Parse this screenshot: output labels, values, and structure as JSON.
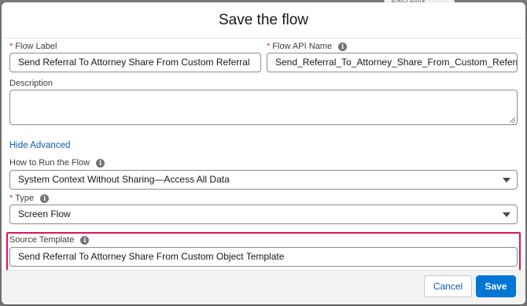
{
  "background": {
    "tab_label": "Auto-Layout"
  },
  "modal": {
    "title": "Save the flow",
    "flow_label": {
      "label": "Flow Label",
      "required": "*",
      "value": "Send Referral To Attorney Share From Custom Referral"
    },
    "flow_api_name": {
      "label": "Flow API Name",
      "required": "*",
      "value": "Send_Referral_To_Attorney_Share_From_Custom_Referral",
      "info_icon": "info-icon"
    },
    "description": {
      "label": "Description",
      "value": ""
    },
    "hide_advanced_link": "Hide Advanced",
    "run_mode": {
      "label": "How to Run the Flow",
      "value": "System Context Without Sharing—Access All Data",
      "info_icon": "info-icon"
    },
    "type": {
      "label": "Type",
      "required": "*",
      "value": "Screen Flow",
      "info_icon": "info-icon"
    },
    "source_template": {
      "label": "Source Template",
      "value": "Send Referral To Attorney Share From Custom Object Template",
      "info_icon": "info-icon"
    },
    "buttons": {
      "cancel": "Cancel",
      "save": "Save"
    }
  },
  "colors": {
    "accent": "#0176d3",
    "link": "#0b5cab",
    "required": "#c23934",
    "highlight": "#e0115f"
  }
}
